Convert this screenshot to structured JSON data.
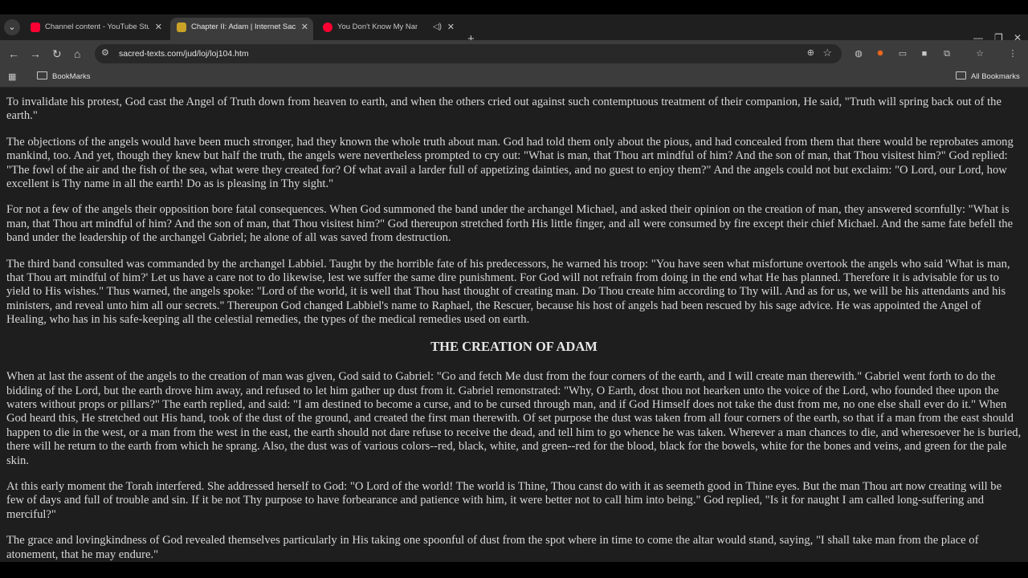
{
  "tabs": [
    {
      "title": "Channel content - YouTube Studio",
      "favicon_color": "#ff0033"
    },
    {
      "title": "Chapter II: Adam | Internet Sacred Text Archive",
      "favicon_color": "#c9a227"
    },
    {
      "title": "You Don't Know My Name",
      "favicon_color": "#ff0033"
    }
  ],
  "address_bar": {
    "url": "sacred-texts.com/jud/loj/loj104.htm"
  },
  "bookmarks": {
    "left_folder": "BookMarks",
    "right_folder": "All Bookmarks"
  },
  "page": {
    "paragraphs_before": [
      "To invalidate his protest, God cast the Angel of Truth down from heaven to earth, and when the others cried out against such contemptuous treatment of their companion, He said, \"Truth will spring back out of the earth.\"",
      "The objections of the angels would have been much stronger, had they known the whole truth about man. God had told them only about the pious, and had concealed from them that there would be reprobates among mankind, too. And yet, though they knew but half the truth, the angels were nevertheless prompted to cry out: \"What is man, that Thou art mindful of him? And the son of man, that Thou visitest him?\" God replied: \"The fowl of the air and the fish of the sea, what were they created for? Of what avail a larder full of appetizing dainties, and no guest to enjoy them?\" And the angels could not but exclaim: \"O Lord, our Lord, how excellent is Thy name in all the earth! Do as is pleasing in Thy sight.\"",
      "For not a few of the angels their opposition bore fatal consequences. When God summoned the band under the archangel Michael, and asked their opinion on the creation of man, they answered scornfully: \"What is man, that Thou art mindful of him? And the son of man, that Thou visitest him?\" God thereupon stretched forth His little finger, and all were consumed by fire except their chief Michael. And the same fate befell the band under the leadership of the archangel Gabriel; he alone of all was saved from destruction.",
      "The third band consulted was commanded by the archangel Labbiel. Taught by the horrible fate of his predecessors, he warned his troop: \"You have seen what misfortune overtook the angels who said 'What is man, that Thou art mindful of him?' Let us have a care not to do likewise, lest we suffer the same dire punishment. For God will not refrain from doing in the end what He has planned. Therefore it is advisable for us to yield to His wishes.\" Thus warned, the angels spoke: \"Lord of the world, it is well that Thou hast thought of creating man. Do Thou create him according to Thy will. And as for us, we will be his attendants and his ministers, and reveal unto him all our secrets.\" Thereupon God changed Labbiel's name to Raphael, the Rescuer, because his host of angels had been rescued by his sage advice. He was appointed the Angel of Healing, who has in his safe-keeping all the celestial remedies, the types of the medical remedies used on earth."
    ],
    "heading": "THE CREATION OF ADAM",
    "paragraphs_after": [
      "When at last the assent of the angels to the creation of man was given, God said to Gabriel: \"Go and fetch Me dust from the four corners of the earth, and I will create man therewith.\" Gabriel went forth to do the bidding of the Lord, but the earth drove him away, and refused to let him gather up dust from it. Gabriel remonstrated: \"Why, O Earth, dost thou not hearken unto the voice of the Lord, who founded thee upon the waters without props or pillars?\" The earth replied, and said: \"I am destined to become a curse, and to be cursed through man, and if God Himself does not take the dust from me, no one else shall ever do it.\" When God heard this, He stretched out His hand, took of the dust of the ground, and created the first man therewith. Of set purpose the dust was taken from all four corners of the earth, so that if a man from the east should happen to die in the west, or a man from the west in the east, the earth should not dare refuse to receive the dead, and tell him to go whence he was taken. Wherever a man chances to die, and wheresoever he is buried, there will he return to the earth from which he sprang. Also, the dust was of various colors--red, black, white, and green--red for the blood, black for the bowels, white for the bones and veins, and green for the pale skin.",
      "At this early moment the Torah interfered. She addressed herself to God: \"O Lord of the world! The world is Thine, Thou canst do with it as seemeth good in Thine eyes. But the man Thou art now creating will be few of days and full of trouble and sin. If it be not Thy purpose to have forbearance and patience with him, it were better not to call him into being.\" God replied, \"Is it for naught I am called long-suffering and merciful?\"",
      "The grace and lovingkindness of God revealed themselves particularly in His taking one spoonful of dust from the spot where in time to come the altar would stand, saying, \"I shall take man from the place of atonement, that he may endure.\""
    ]
  }
}
